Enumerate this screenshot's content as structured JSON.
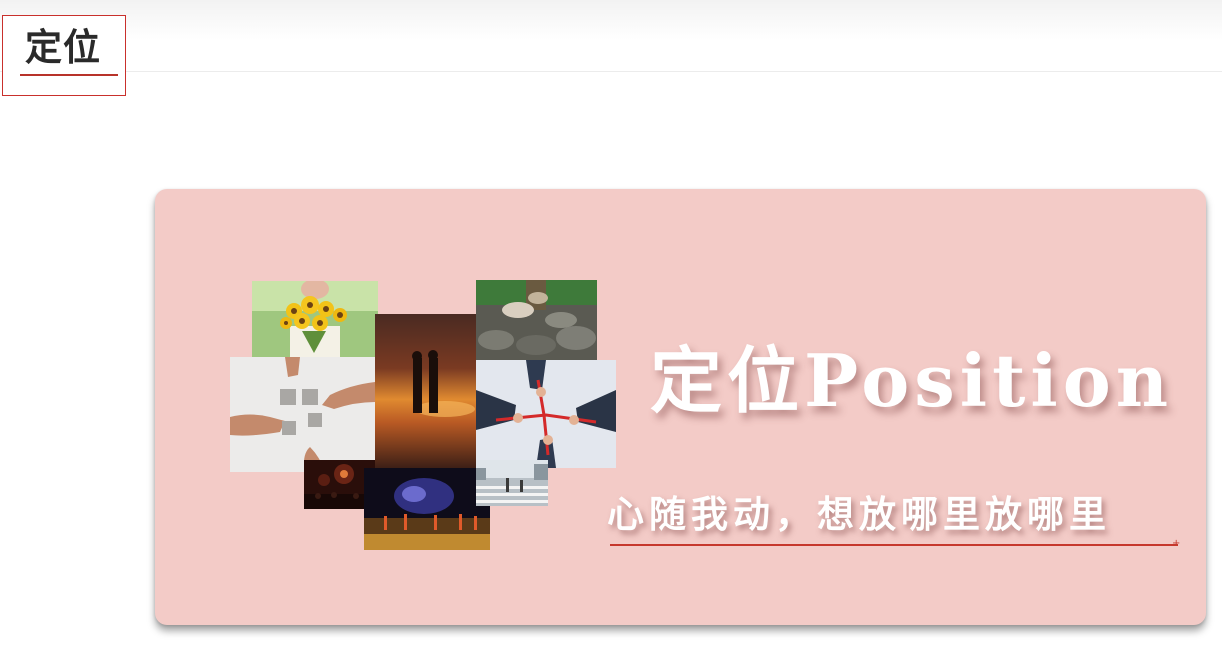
{
  "header": {
    "title": "定位"
  },
  "banner": {
    "heading": "定位Position",
    "subheading": "心随我动，想放哪里放哪里"
  },
  "collage": [
    {
      "subject": "sunflower bouquet"
    },
    {
      "subject": "couple walking on beach at sunset"
    },
    {
      "subject": "feet walking on rocks"
    },
    {
      "subject": "hands connecting puzzle pieces"
    },
    {
      "subject": "hands tied together with red rope"
    },
    {
      "subject": "fireworks crowd"
    },
    {
      "subject": "night festival lights"
    },
    {
      "subject": "city street crosswalk"
    }
  ],
  "colors": {
    "banner_bg": "#f3cbc7",
    "accent_red": "#c6382d",
    "title_text": "#2a2a2a"
  }
}
